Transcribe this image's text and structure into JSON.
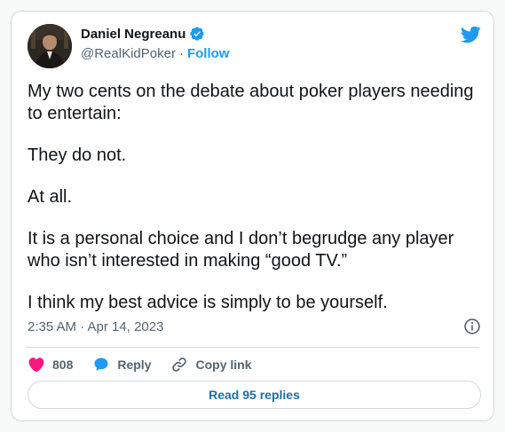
{
  "author": {
    "name": "Daniel Negreanu",
    "handle": "@RealKidPoker",
    "separator": "·",
    "follow_label": "Follow",
    "verified_icon": "verified-badge-icon",
    "avatar_icon": "profile-photo"
  },
  "logo_icon": "twitter-bird-icon",
  "tweet": {
    "paragraphs": [
      "My two cents on the debate about poker players needing to entertain:",
      "They do not.",
      "At all.",
      "It is a personal choice and I don’t begrudge any player who isn’t interested in making “good TV.”",
      "I think my best advice is simply to be yourself."
    ],
    "timestamp": "2:35 AM · Apr 14, 2023"
  },
  "actions": {
    "like_count": "808",
    "reply_label": "Reply",
    "copy_link_label": "Copy link"
  },
  "read_replies_label": "Read 95 replies",
  "colors": {
    "accent": "#1d9bf0",
    "like": "#f91880",
    "text": "#0f1419",
    "muted": "#536471",
    "border": "#cfd9de"
  }
}
